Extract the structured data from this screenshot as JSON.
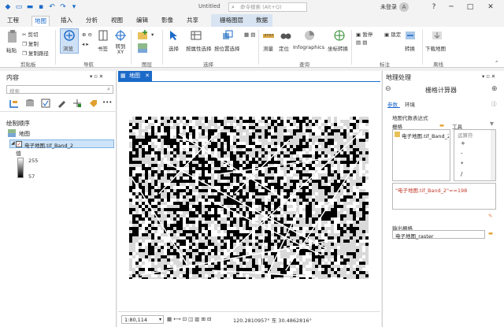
{
  "titlebar": {
    "doc_title": "Untitled",
    "search_placeholder": "命令搜索 (Alt+Q)",
    "user_label": "未登录",
    "avatar_letter": "A",
    "help": "?",
    "minimize": "─",
    "maximize": "□",
    "close": "✕"
  },
  "ribbon_tabs": {
    "project": "工程",
    "map": "地图",
    "insert": "插入",
    "analysis": "分析",
    "view": "视图",
    "edit": "编辑",
    "imagery": "影像",
    "share": "共享",
    "raster_layer": "栅格图层",
    "data": "数据"
  },
  "ribbon": {
    "paste": "粘贴",
    "cut": "剪切",
    "copy": "复制",
    "copy_path": "复制路径",
    "clipboard_group": "剪贴板",
    "explore": "浏览",
    "bookmark": "书签",
    "goto": "转到 XY",
    "navigate_group": "导航",
    "layer_group": "图层",
    "select": "选择",
    "select_by_attr": "按属性选择",
    "select_by_loc": "按位置选择",
    "selection_group": "选择",
    "measure": "测量",
    "locate": "定位",
    "infographics": "Infographics",
    "coord_convert": "坐标转换",
    "query_group": "查询",
    "pause": "暂停",
    "lock": "锁定",
    "convert": "转换",
    "label_group": "标注",
    "download_map": "下载地图",
    "offline_group": "离线"
  },
  "contents": {
    "title": "内容",
    "search_placeholder": "搜索",
    "drawing_order": "绘制顺序",
    "map_name": "地图",
    "layer_name": "电子地图.tif_Band_2",
    "value_label": "值",
    "max_value": "255",
    "min_value": "57",
    "more": "•••"
  },
  "mapview": {
    "tab_label": "地图",
    "scale": "1:80,114",
    "coordinates": "120.2810957° 东 30.4862816°"
  },
  "geoprocessing": {
    "title": "地理处理",
    "tool_name": "栅格计算器",
    "tab_params": "参数",
    "tab_env": "环境",
    "map_algebra_label": "地图代数表达式",
    "rasters_label": "栅格",
    "tools_label": "工具",
    "raster_item": "电子地图.tif_Band_2",
    "operators_label": "运算符",
    "operators": [
      "+",
      "-",
      "*",
      "/"
    ],
    "expression": "\"电子地图.tif_Band_2\"==198",
    "output_label": "输出栅格",
    "output_value": "电子地图_raster"
  },
  "colors": {
    "accent": "#1b6ac9",
    "ribbon_bg": "#ffffff",
    "chrome_bg": "#f0f0f0"
  }
}
